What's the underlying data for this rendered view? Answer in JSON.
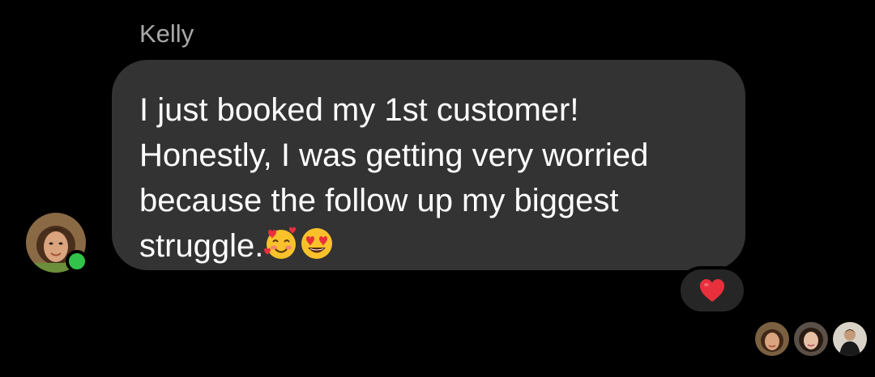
{
  "conversation": {
    "sender_name": "Kelly",
    "message": {
      "lines": [
        "I just booked my 1st customer!",
        "Honestly, I was getting very worried",
        "because the follow up my biggest",
        "struggle."
      ],
      "trailing_emojis": [
        "smiling-face-with-hearts",
        "heart-eyes-face"
      ]
    },
    "reaction": "red-heart",
    "sender_status": "online",
    "seen_by_count": 3
  },
  "colors": {
    "background": "#000000",
    "bubble": "#333333",
    "name_text": "#a8a8a8",
    "message_text": "#ffffff",
    "online": "#31c34a",
    "heart": "#e8303c"
  }
}
